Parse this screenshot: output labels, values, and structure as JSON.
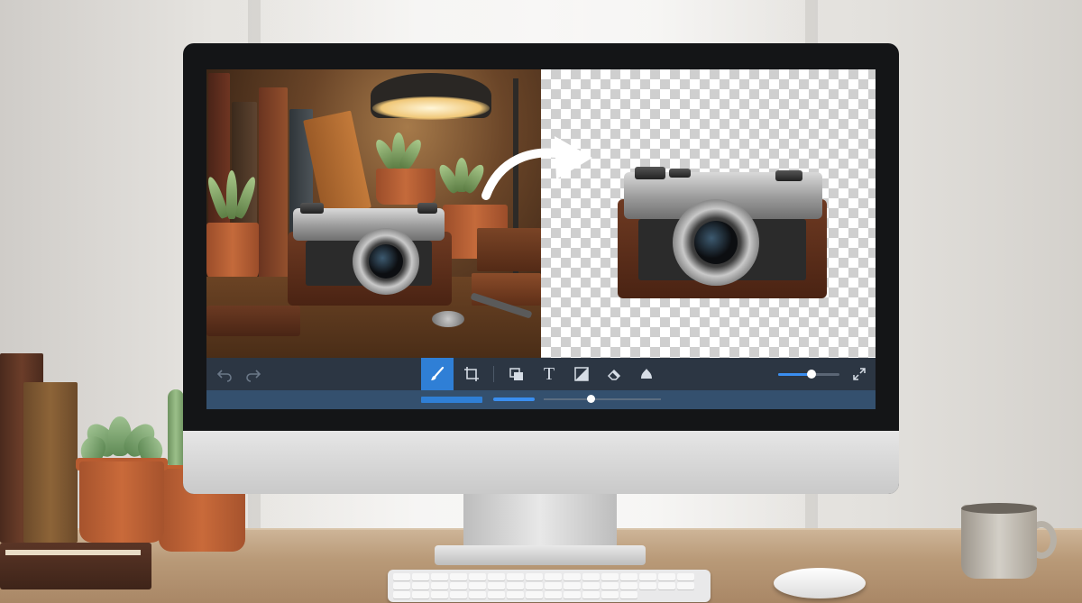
{
  "scene": {
    "description_elements": [
      "monitor",
      "desk",
      "keyboard",
      "mouse",
      "mug",
      "books",
      "plants"
    ]
  },
  "editor": {
    "toolbar": {
      "undo_icon": "undo-icon",
      "redo_icon": "redo-icon",
      "tools": [
        {
          "name": "brush",
          "icon": "brush-icon",
          "active": true
        },
        {
          "name": "crop",
          "icon": "crop-icon",
          "active": false
        },
        {
          "name": "layers",
          "icon": "layers-icon",
          "active": false
        },
        {
          "name": "text",
          "icon": "text-icon",
          "glyph": "T",
          "active": false
        },
        {
          "name": "adjust",
          "icon": "adjust-icon",
          "active": false
        },
        {
          "name": "eraser",
          "icon": "eraser-icon",
          "active": false
        },
        {
          "name": "fill",
          "icon": "fill-icon",
          "active": false
        }
      ],
      "zoom_level": 0.55,
      "fullscreen_icon": "fullscreen-icon"
    },
    "statusbar": {
      "brush_size_level": 0.4
    },
    "colors": {
      "accent": "#2f7fd6",
      "toolbar_bg": "#2c3643",
      "statusbar_bg": "#34506e"
    }
  }
}
